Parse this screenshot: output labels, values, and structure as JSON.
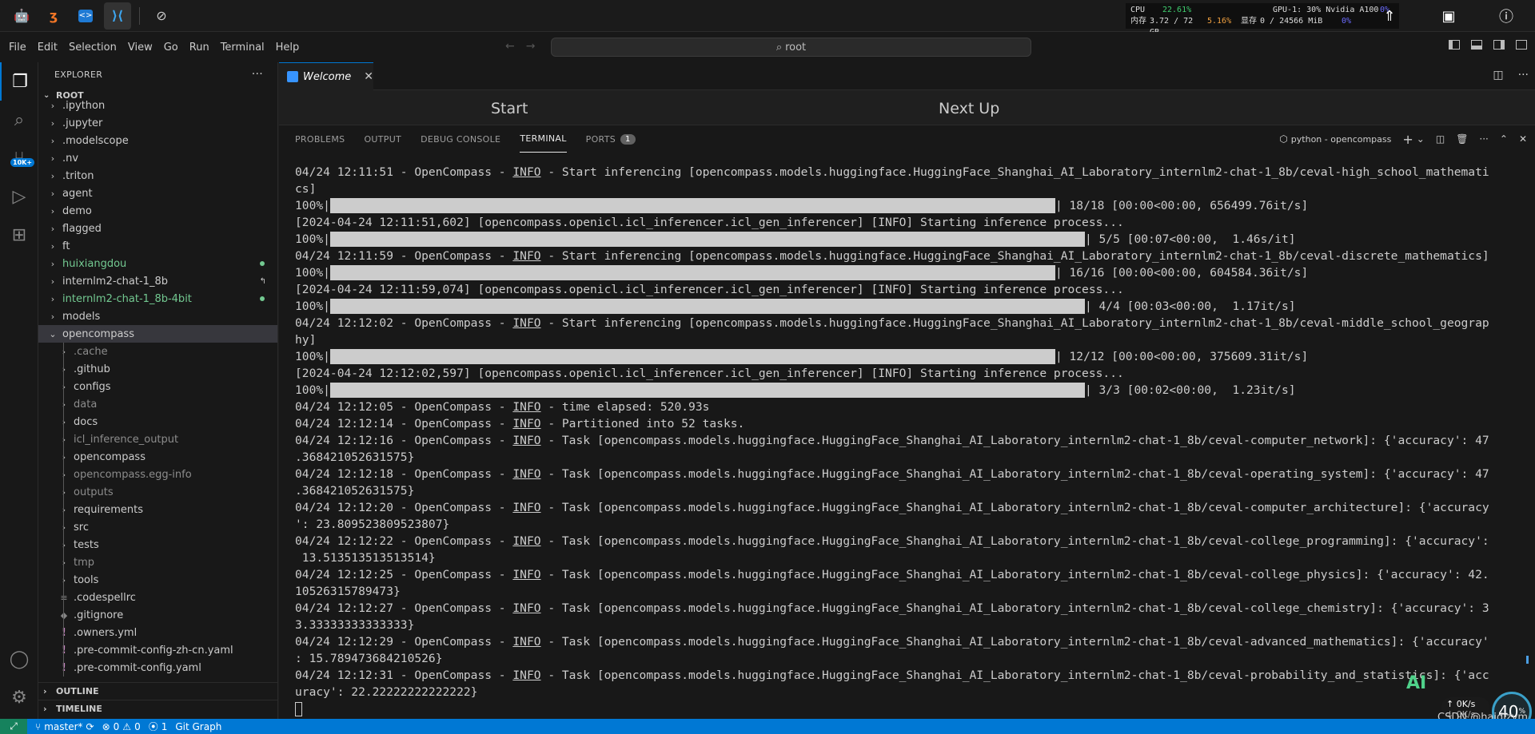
{
  "sysbar": {
    "icons": [
      "bot-avatar",
      "jupyter",
      "code",
      "vscode"
    ],
    "compass_icon": "compass",
    "stats": {
      "cpu_label": "CPU",
      "cpu_value": "22.61%",
      "gpu_label": "GPU-1: 30% Nvidia A100",
      "gpu_value": "0%",
      "mem_label": "内存",
      "mem_value": "3.72 / 72 GB",
      "mem_percent": "5.16%",
      "vram_label": "显存",
      "vram_value": "0 / 24566 MiB",
      "vram_percent": "0%"
    }
  },
  "menubar": {
    "items": [
      "File",
      "Edit",
      "Selection",
      "View",
      "Go",
      "Run",
      "Terminal",
      "Help"
    ],
    "search_text": "root"
  },
  "activity": {
    "badge": "10K+"
  },
  "explorer": {
    "title": "EXPLORER",
    "more": "···",
    "root": "ROOT",
    "items": [
      {
        "label": ".ipython",
        "level": 1,
        "state": ""
      },
      {
        "label": ".jupyter",
        "level": 1,
        "state": ""
      },
      {
        "label": ".modelscope",
        "level": 1,
        "state": ""
      },
      {
        "label": ".nv",
        "level": 1,
        "state": ""
      },
      {
        "label": ".triton",
        "level": 1,
        "state": ""
      },
      {
        "label": "agent",
        "level": 1,
        "state": ""
      },
      {
        "label": "demo",
        "level": 1,
        "state": ""
      },
      {
        "label": "flagged",
        "level": 1,
        "state": ""
      },
      {
        "label": "ft",
        "level": 1,
        "state": ""
      },
      {
        "label": "huixiangdou",
        "level": 1,
        "state": "green"
      },
      {
        "label": "internlm2-chat-1_8b",
        "level": 1,
        "state": "link"
      },
      {
        "label": "internlm2-chat-1_8b-4bit",
        "level": 1,
        "state": "green"
      },
      {
        "label": "models",
        "level": 1,
        "state": ""
      },
      {
        "label": "opencompass",
        "level": 1,
        "state": "open"
      },
      {
        "label": ".cache",
        "level": 2,
        "state": "dim"
      },
      {
        "label": ".github",
        "level": 2,
        "state": ""
      },
      {
        "label": "configs",
        "level": 2,
        "state": ""
      },
      {
        "label": "data",
        "level": 2,
        "state": "dim"
      },
      {
        "label": "docs",
        "level": 2,
        "state": ""
      },
      {
        "label": "icl_inference_output",
        "level": 2,
        "state": "dim"
      },
      {
        "label": "opencompass",
        "level": 2,
        "state": ""
      },
      {
        "label": "opencompass.egg-info",
        "level": 2,
        "state": "dim"
      },
      {
        "label": "outputs",
        "level": 2,
        "state": "dim"
      },
      {
        "label": "requirements",
        "level": 2,
        "state": ""
      },
      {
        "label": "src",
        "level": 2,
        "state": ""
      },
      {
        "label": "tests",
        "level": 2,
        "state": ""
      },
      {
        "label": "tmp",
        "level": 2,
        "state": "dim"
      },
      {
        "label": "tools",
        "level": 2,
        "state": ""
      },
      {
        "label": ".codespellrc",
        "level": 2,
        "state": "file"
      },
      {
        "label": ".gitignore",
        "level": 2,
        "state": "file-git"
      },
      {
        "label": ".owners.yml",
        "level": 2,
        "state": "file-yml"
      },
      {
        "label": ".pre-commit-config-zh-cn.yaml",
        "level": 2,
        "state": "file-yml"
      },
      {
        "label": ".pre-commit-config.yaml",
        "level": 2,
        "state": "file-yml"
      }
    ],
    "outline": "OUTLINE",
    "timeline": "TIMELINE"
  },
  "editor": {
    "tab_label": "Welcome",
    "tab_close": "✕",
    "welcome_start": "Start",
    "welcome_next": "Next Up"
  },
  "panel": {
    "tabs": [
      "PROBLEMS",
      "OUTPUT",
      "DEBUG CONSOLE",
      "TERMINAL",
      "PORTS"
    ],
    "active_tab": "TERMINAL",
    "ports_count": "1",
    "terminal_name": "python - opencompass"
  },
  "terminal": {
    "lines": [
      {
        "pre": "04/24 12:11:51 - OpenCompass - ",
        "u": "INFO",
        "post": " - Start inferencing [opencompass.models.huggingface.HuggingFace_Shanghai_AI_Laboratory_internlm2-chat-1_8b/ceval-high_school_mathemati"
      },
      {
        "text": "cs]"
      },
      {
        "pct": "100%|",
        "fill": 0.73,
        "tail": "| 18/18 [00:00<00:00, 656499.76it/s]"
      },
      {
        "text": "[2024-04-24 12:11:51,602] [opencompass.openicl.icl_inferencer.icl_gen_inferencer] [INFO] Starting inference process..."
      },
      {
        "pct": "100%|",
        "fill": 0.76,
        "tail": "| 5/5 [00:07<00:00,  1.46s/it]"
      },
      {
        "pre": "04/24 12:11:59 - OpenCompass - ",
        "u": "INFO",
        "post": " - Start inferencing [opencompass.models.huggingface.HuggingFace_Shanghai_AI_Laboratory_internlm2-chat-1_8b/ceval-discrete_mathematics]"
      },
      {
        "pct": "100%|",
        "fill": 0.73,
        "tail": "| 16/16 [00:00<00:00, 604584.36it/s]"
      },
      {
        "text": "[2024-04-24 12:11:59,074] [opencompass.openicl.icl_inferencer.icl_gen_inferencer] [INFO] Starting inference process..."
      },
      {
        "pct": "100%|",
        "fill": 0.76,
        "tail": "| 4/4 [00:03<00:00,  1.17it/s]"
      },
      {
        "pre": "04/24 12:12:02 - OpenCompass - ",
        "u": "INFO",
        "post": " - Start inferencing [opencompass.models.huggingface.HuggingFace_Shanghai_AI_Laboratory_internlm2-chat-1_8b/ceval-middle_school_geograp"
      },
      {
        "text": "hy]"
      },
      {
        "pct": "100%|",
        "fill": 0.73,
        "tail": "| 12/12 [00:00<00:00, 375609.31it/s]"
      },
      {
        "text": "[2024-04-24 12:12:02,597] [opencompass.openicl.icl_inferencer.icl_gen_inferencer] [INFO] Starting inference process..."
      },
      {
        "pct": "100%|",
        "fill": 0.76,
        "tail": "| 3/3 [00:02<00:00,  1.23it/s]"
      },
      {
        "pre": "04/24 12:12:05 - OpenCompass - ",
        "u": "INFO",
        "post": " - time elapsed: 520.93s"
      },
      {
        "pre": "04/24 12:12:14 - OpenCompass - ",
        "u": "INFO",
        "post": " - Partitioned into 52 tasks."
      },
      {
        "pre": "04/24 12:12:16 - OpenCompass - ",
        "u": "INFO",
        "post": " - Task [opencompass.models.huggingface.HuggingFace_Shanghai_AI_Laboratory_internlm2-chat-1_8b/ceval-computer_network]: {'accuracy': 47"
      },
      {
        "text": ".368421052631575}"
      },
      {
        "pre": "04/24 12:12:18 - OpenCompass - ",
        "u": "INFO",
        "post": " - Task [opencompass.models.huggingface.HuggingFace_Shanghai_AI_Laboratory_internlm2-chat-1_8b/ceval-operating_system]: {'accuracy': 47"
      },
      {
        "text": ".368421052631575}"
      },
      {
        "pre": "04/24 12:12:20 - OpenCompass - ",
        "u": "INFO",
        "post": " - Task [opencompass.models.huggingface.HuggingFace_Shanghai_AI_Laboratory_internlm2-chat-1_8b/ceval-computer_architecture]: {'accuracy"
      },
      {
        "text": "': 23.809523809523807}"
      },
      {
        "pre": "04/24 12:12:22 - OpenCompass - ",
        "u": "INFO",
        "post": " - Task [opencompass.models.huggingface.HuggingFace_Shanghai_AI_Laboratory_internlm2-chat-1_8b/ceval-college_programming]: {'accuracy':"
      },
      {
        "text": " 13.513513513513514}"
      },
      {
        "pre": "04/24 12:12:25 - OpenCompass - ",
        "u": "INFO",
        "post": " - Task [opencompass.models.huggingface.HuggingFace_Shanghai_AI_Laboratory_internlm2-chat-1_8b/ceval-college_physics]: {'accuracy': 42."
      },
      {
        "text": "10526315789473}"
      },
      {
        "pre": "04/24 12:12:27 - OpenCompass - ",
        "u": "INFO",
        "post": " - Task [opencompass.models.huggingface.HuggingFace_Shanghai_AI_Laboratory_internlm2-chat-1_8b/ceval-college_chemistry]: {'accuracy': 3"
      },
      {
        "text": "3.33333333333333}"
      },
      {
        "pre": "04/24 12:12:29 - OpenCompass - ",
        "u": "INFO",
        "post": " - Task [opencompass.models.huggingface.HuggingFace_Shanghai_AI_Laboratory_internlm2-chat-1_8b/ceval-advanced_mathematics]: {'accuracy'"
      },
      {
        "text": ": 15.789473684210526}"
      },
      {
        "pre": "04/24 12:12:31 - OpenCompass - ",
        "u": "INFO",
        "post": " - Task [opencompass.models.huggingface.HuggingFace_Shanghai_AI_Laboratory_internlm2-chat-1_8b/ceval-probability_and_statistics]: {'acc"
      },
      {
        "text": "uracy': 22.22222222222222}"
      }
    ]
  },
  "overlay": {
    "ai_logo": "AI",
    "net_speed": "0K/s",
    "net_speed2": "0K/s",
    "circle_value": "40",
    "circle_unit": "%",
    "watermark": "CSDN @haidizym"
  },
  "statusbar": {
    "branch": "master*",
    "errors": "0",
    "warnings": "0",
    "ports": "1",
    "git_graph": "Git Graph"
  }
}
